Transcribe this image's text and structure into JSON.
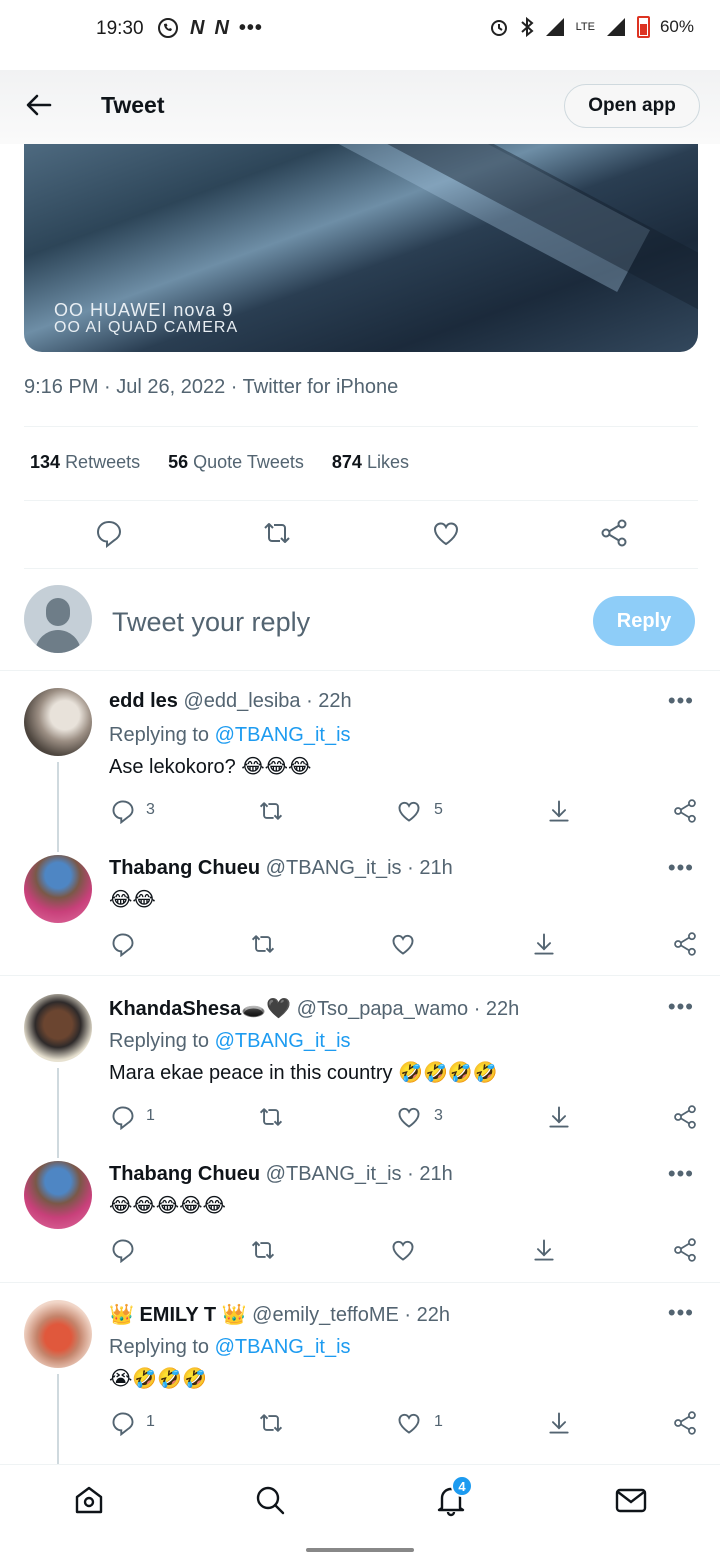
{
  "status_bar": {
    "time": "19:30",
    "left_icons": [
      "whatsapp-icon",
      "n-icon",
      "n-icon",
      "more-dots-icon"
    ],
    "battery": "60%",
    "network": "LTE"
  },
  "header": {
    "title": "Tweet",
    "open_app": "Open app"
  },
  "media": {
    "watermark_line1": "OO HUAWEI nova 9",
    "watermark_line2": "OO AI QUAD CAMERA"
  },
  "tweet": {
    "meta": "9:16 PM · Jul 26, 2022 · Twitter for iPhone",
    "retweets_count": "134",
    "retweets_label": "Retweets",
    "quotes_count": "56",
    "quotes_label": "Quote Tweets",
    "likes_count": "874",
    "likes_label": "Likes"
  },
  "compose": {
    "placeholder": "Tweet your reply",
    "button": "Reply"
  },
  "replies": [
    {
      "name": "edd les",
      "handle": "@edd_lesiba · 22h",
      "replying_prefix": "Replying to",
      "replying_to": "@TBANG_it_is",
      "text": "Ase lekokoro? 😂😂😂",
      "reply_count": "3",
      "like_count": "5"
    },
    {
      "name": "Thabang Chueu",
      "handle": "@TBANG_it_is · 21h",
      "text": "😂😂"
    },
    {
      "name": "KhandaShesa🕳️🖤",
      "handle": "@Tso_papa_wamo · 22h",
      "replying_prefix": "Replying to",
      "replying_to": "@TBANG_it_is",
      "text": "Mara ekae peace in this country 🤣🤣🤣🤣",
      "reply_count": "1",
      "like_count": "3"
    },
    {
      "name": "Thabang Chueu",
      "handle": "@TBANG_it_is · 21h",
      "text": "😂😂😂😂😂"
    },
    {
      "name": "👑 EMILY T 👑",
      "handle": "@emily_teffoME · 22h",
      "replying_prefix": "Replying to",
      "replying_to": "@TBANG_it_is",
      "text": "😭🤣🤣🤣",
      "reply_count": "1",
      "like_count": "1"
    }
  ],
  "bottom_nav": {
    "notifications_badge": "4"
  },
  "colors": {
    "accent": "#1d9bf0",
    "reply_button": "#8ecdf8",
    "secondary_text": "#536471"
  }
}
